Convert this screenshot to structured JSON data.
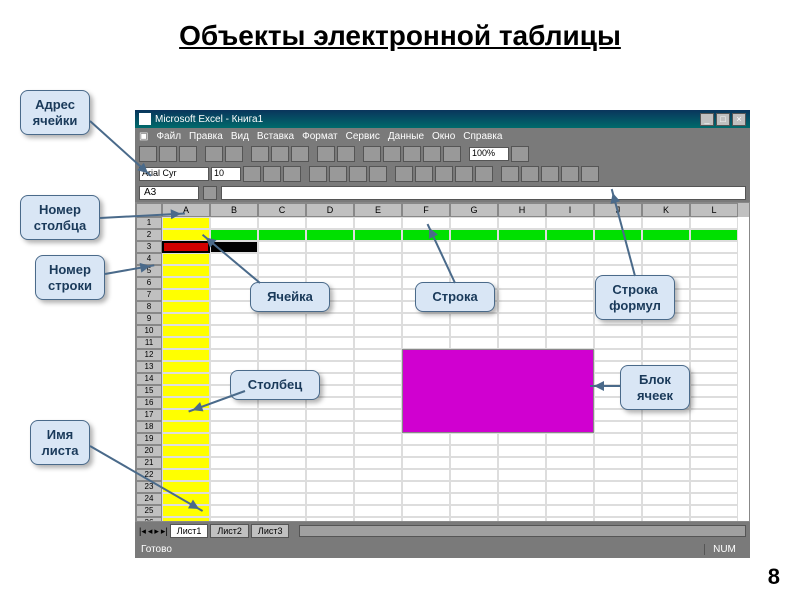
{
  "slide": {
    "title": "Объекты электронной таблицы",
    "page_num": "8"
  },
  "window": {
    "title": "Microsoft Excel - Книга1",
    "menus": [
      "Файл",
      "Правка",
      "Вид",
      "Вставка",
      "Формат",
      "Сервис",
      "Данные",
      "Окно",
      "Справка"
    ],
    "font_name": "Arial Cyr",
    "font_size": "10",
    "zoom": "100%",
    "name_box": "A3",
    "status": "Готово",
    "indicator": "NUM"
  },
  "grid": {
    "columns": [
      "A",
      "B",
      "C",
      "D",
      "E",
      "F",
      "G",
      "H",
      "I",
      "J",
      "K",
      "L"
    ],
    "row_count": 26,
    "green_row": 2,
    "yellow_column": "A",
    "red_cell": "A3",
    "black_cell": "B3",
    "magenta_block": "F12:I18"
  },
  "sheets": {
    "tabs": [
      "Лист1",
      "Лист2",
      "Лист3"
    ],
    "active": 0
  },
  "callouts": {
    "cell_address": "Адрес ячейки",
    "column_number": "Номер столбца",
    "row_number": "Номер строки",
    "sheet_name": "Имя листа",
    "cell": "Ячейка",
    "row": "Строка",
    "formula_bar": "Строка формул",
    "column": "Столбец",
    "cell_block": "Блок ячеек"
  }
}
